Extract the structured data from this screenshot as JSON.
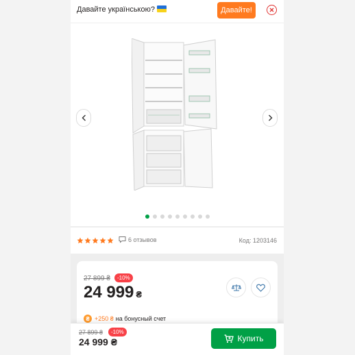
{
  "banner": {
    "text": "Давайте українською?",
    "button_label": "Давайте!"
  },
  "gallery": {
    "image_alt": "fridge-image",
    "slide_count": 9,
    "active_slide": 1
  },
  "rating": {
    "stars": 5,
    "reviews_label": "6 отзывов",
    "code_label": "Код: 1203146"
  },
  "price": {
    "old_price": "27 899 ₴",
    "discount": "-10%",
    "current_value": "24 999",
    "currency": "₴",
    "bonus_amount": "+250 ₴",
    "bonus_text": "на бонусный счет"
  },
  "sticky": {
    "old_price": "27 899 ₴",
    "discount": "-10%",
    "price": "24 999 ₴",
    "buy_label": "Купить"
  },
  "colors": {
    "accent_orange": "#ff7a1f",
    "buy_green": "#00a046",
    "discount_red": "#f84147",
    "star_orange": "#ff7a1f"
  }
}
